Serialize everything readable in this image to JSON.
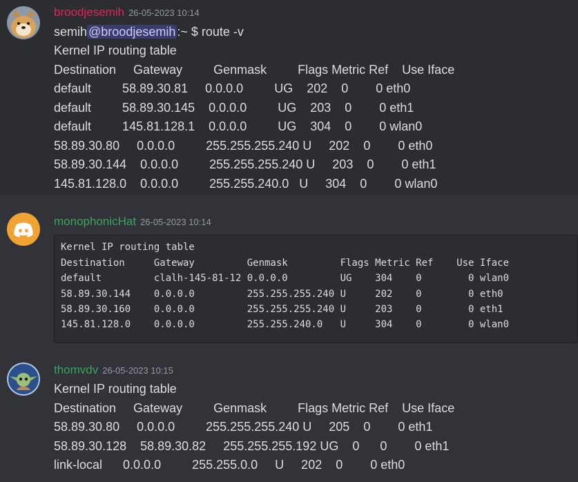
{
  "colors": {
    "user1": "#e0245e",
    "user2": "#3ba55c",
    "user3": "#3ba55c",
    "discord_blurple": "#5865f2",
    "discord_orange": "#f0a232"
  },
  "messages": [
    {
      "avatar_icon": "shiba-dog-avatar",
      "username": "broodjesemih",
      "timestamp": "26-05-2023 10:14",
      "prompt": {
        "user": "semih",
        "mention": "@broodjesemih",
        "rest": ":~ $ route -v"
      },
      "lines": [
        "Kernel IP routing table",
        "Destination     Gateway         Genmask         Flags Metric Ref    Use Iface",
        "default         58.89.30.81     0.0.0.0         UG    202    0        0 eth0",
        "default         58.89.30.145    0.0.0.0         UG    203    0        0 eth1",
        "default         145.81.128.1    0.0.0.0         UG    304    0        0 wlan0",
        "58.89.30.80     0.0.0.0         255.255.255.240 U     202    0        0 eth0",
        "58.89.30.144    0.0.0.0         255.255.255.240 U     203    0        0 eth1",
        "145.81.128.0    0.0.0.0         255.255.240.0   U     304    0        0 wlan0"
      ]
    },
    {
      "avatar_icon": "discord-logo-avatar",
      "username": "monophonicHat",
      "timestamp": "26-05-2023 10:14",
      "code_lines": [
        "Kernel IP routing table",
        "Destination     Gateway         Genmask         Flags Metric Ref    Use Iface",
        "default         clalh-145-81-12 0.0.0.0         UG    304    0        0 wlan0",
        "58.89.30.144    0.0.0.0         255.255.255.240 U     202    0        0 eth0",
        "58.89.30.160    0.0.0.0         255.255.255.240 U     203    0        0 eth1",
        "145.81.128.0    0.0.0.0         255.255.240.0   U     304    0        0 wlan0"
      ]
    },
    {
      "avatar_icon": "grogu-avatar",
      "username": "thomvdv",
      "timestamp": "26-05-2023 10:15",
      "lines": [
        "Kernel IP routing table",
        "Destination     Gateway         Genmask         Flags Metric Ref    Use Iface",
        "58.89.30.80     0.0.0.0         255.255.255.240 U     205    0        0 eth1",
        "58.89.30.128    58.89.30.82     255.255.255.192 UG    0      0        0 eth1",
        "link-local      0.0.0.0         255.255.0.0     U     202    0        0 eth0"
      ]
    }
  ]
}
